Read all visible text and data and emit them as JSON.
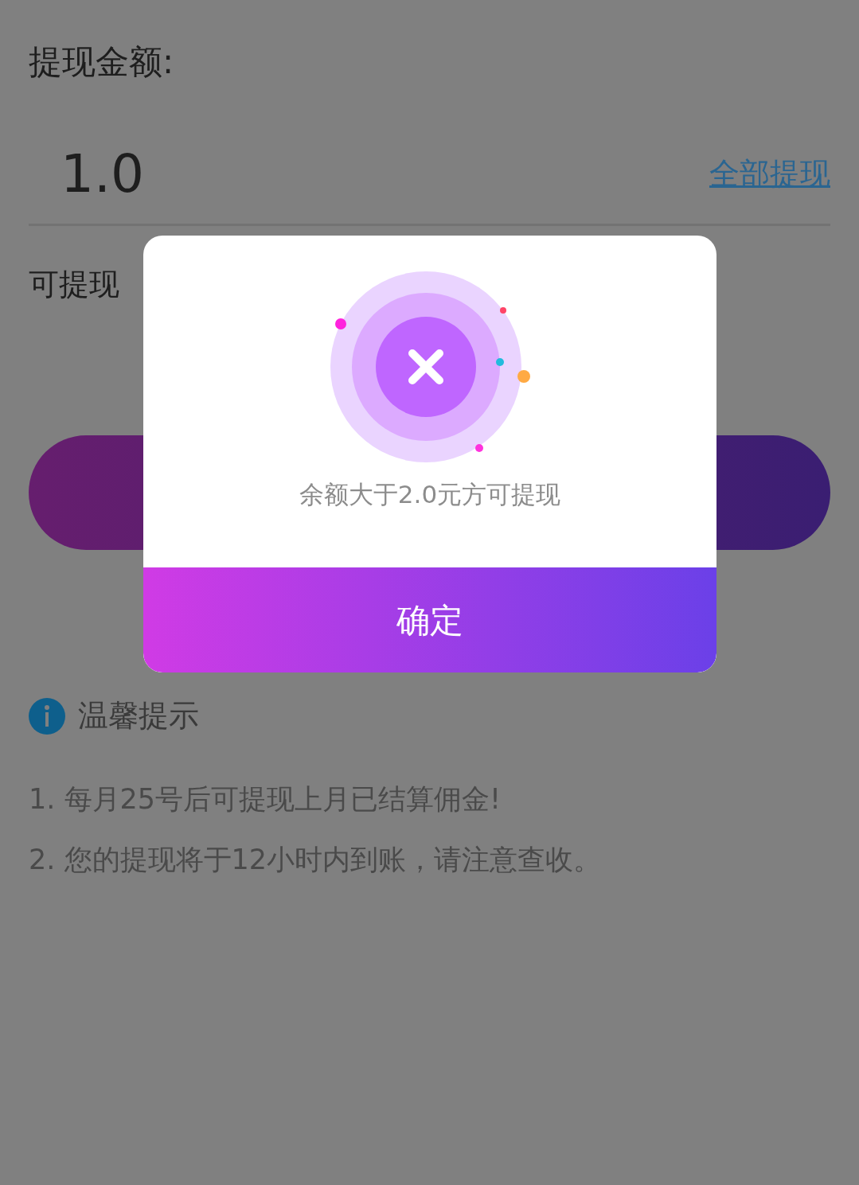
{
  "form": {
    "amount_label": "提现金额:",
    "amount_value": "1.0",
    "withdraw_all": "全部提现",
    "available_label": "可提现"
  },
  "tips": {
    "title": "温馨提示",
    "items": [
      "1. 每月25号后可提现上月已结算佣金!",
      "2. 您的提现将于12小时内到账，请注意查收。"
    ]
  },
  "dialog": {
    "message": "余额大于2.0元方可提现",
    "confirm": "确定"
  }
}
